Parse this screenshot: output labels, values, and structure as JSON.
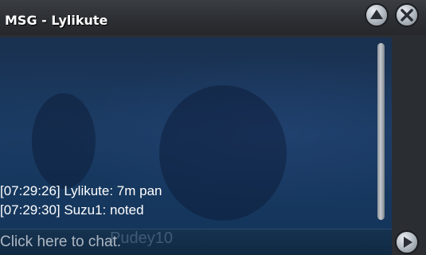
{
  "window": {
    "title": "MSG - Lylikute"
  },
  "buttons": {
    "collapse_icon": "triangle-up-icon",
    "close_icon": "x-icon",
    "send_icon": "triangle-right-icon"
  },
  "messages": [
    {
      "text": "[07:29:26] Lylikute: 7m pan"
    },
    {
      "text": "[07:29:30] Suzu1: noted"
    }
  ],
  "input": {
    "placeholder": "Click here to chat."
  },
  "background": {
    "watermark_text": "Pudey10"
  },
  "colors": {
    "chat_bg": "#183a62",
    "titlebar": "#2c2f33",
    "text": "#ffffff"
  }
}
